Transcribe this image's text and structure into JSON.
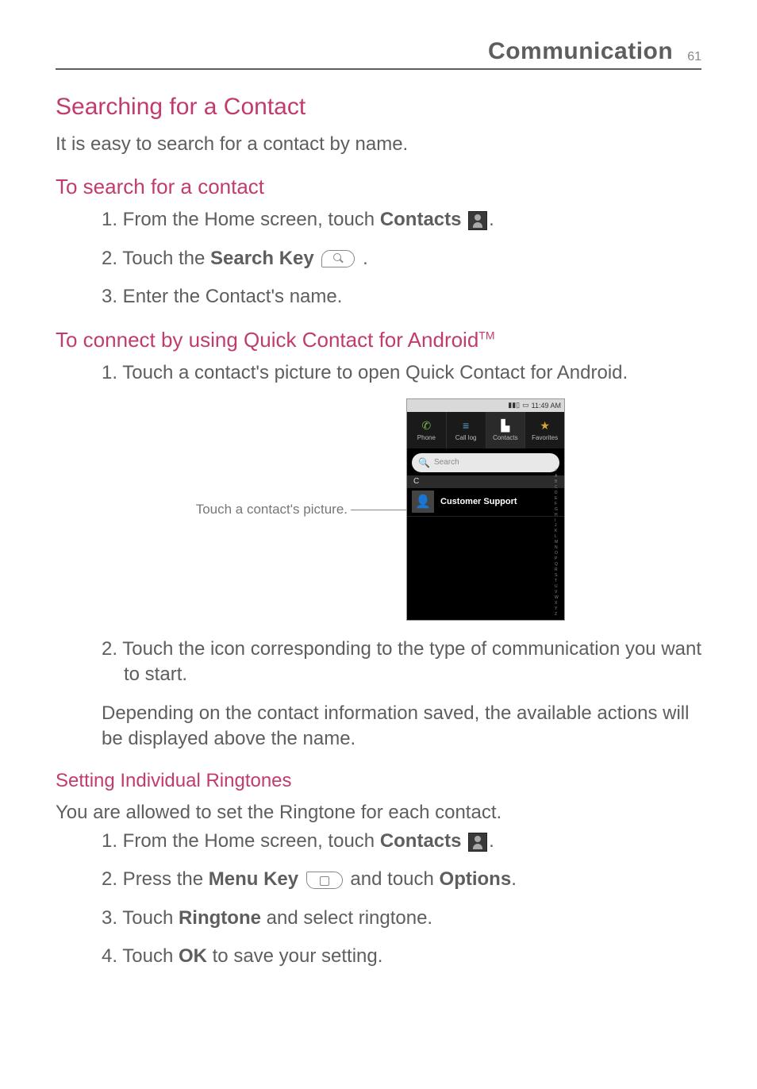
{
  "header": {
    "section": "Communication",
    "page": "61"
  },
  "h1": "Searching for a Contact",
  "intro": "It is easy to search for a contact by name.",
  "search_h2": "To search for a contact",
  "search_steps": {
    "s1a": "1. From the Home screen, touch ",
    "s1b": "Contacts",
    "s1c": ".",
    "s2a": "2. Touch the ",
    "s2b": "Search Key",
    "s2c": " .",
    "s3": "3. Enter the Contact's name."
  },
  "quick_h2a": "To connect by using Quick Contact for Android",
  "quick_h2b": "TM",
  "quick_step1": "1. Touch a contact's picture to open Quick Contact for Android.",
  "caption": "Touch a contact's picture.",
  "screenshot": {
    "time": "11:49 AM",
    "tabs": {
      "phone": "Phone",
      "calllog": "Call log",
      "contacts": "Contacts",
      "favorites": "Favorites"
    },
    "search_placeholder": "Search",
    "section": "C",
    "contact": "Customer Support",
    "alpha": [
      "#",
      "A",
      "B",
      "C",
      "D",
      "E",
      "F",
      "G",
      "H",
      "I",
      "J",
      "K",
      "L",
      "M",
      "N",
      "O",
      "P",
      "Q",
      "R",
      "S",
      "T",
      "U",
      "V",
      "W",
      "X",
      "Y",
      "Z"
    ]
  },
  "quick_step2a": "2. Touch the icon corresponding to the type of communication you want to start.",
  "quick_step2b": "Depending on the contact information saved, the available actions will be displayed above the name.",
  "ringtone_h3": "Setting Individual Ringtones",
  "ringtone_intro": "You are allowed to set the Ringtone for each contact.",
  "ringtone_steps": {
    "s1a": "1. From the Home screen, touch ",
    "s1b": "Contacts",
    "s1c": ".",
    "s2a": "2. Press the ",
    "s2b": "Menu Key",
    "s2c": " and touch ",
    "s2d": "Options",
    "s2e": ".",
    "s3a": "3. Touch ",
    "s3b": "Ringtone",
    "s3c": " and select ringtone.",
    "s4a": "4. Touch ",
    "s4b": "OK",
    "s4c": " to save your setting."
  }
}
